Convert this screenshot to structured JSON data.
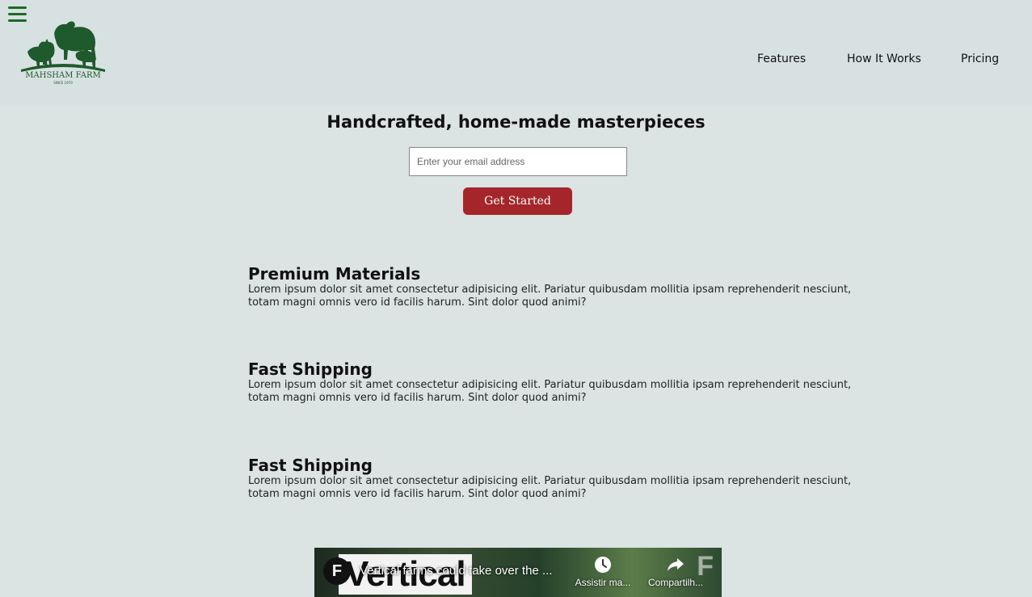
{
  "header": {
    "logo_text": "MAHSHAM FARM",
    "logo_subtext": "SINCE 1970",
    "nav": [
      "Features",
      "How It Works",
      "Pricing"
    ]
  },
  "hero": {
    "title": "Handcrafted, home-made masterpieces",
    "email_placeholder": "Enter your email address",
    "cta_label": "Get Started"
  },
  "features": [
    {
      "title": "Premium Materials",
      "text": "Lorem ipsum dolor sit amet consectetur adipisicing elit. Pariatur quibusdam mollitia ipsam reprehenderit nesciunt, totam magni omnis vero id facilis harum. Sint dolor quod animi?"
    },
    {
      "title": "Fast Shipping",
      "text": "Lorem ipsum dolor sit amet consectetur adipisicing elit. Pariatur quibusdam mollitia ipsam reprehenderit nesciunt, totam magni omnis vero id facilis harum. Sint dolor quod animi?"
    },
    {
      "title": "Fast Shipping",
      "text": "Lorem ipsum dolor sit amet consectetur adipisicing elit. Pariatur quibusdam mollitia ipsam reprehenderit nesciunt, totam magni omnis vero id facilis harum. Sint dolor quod animi?"
    }
  ],
  "video": {
    "channel_initial": "F",
    "background_word": "Vertical",
    "title": "Vertical farms could take over the ...",
    "watch_later_label": "Assistir ma...",
    "share_label": "Compartilh..."
  },
  "colors": {
    "page_background": "#dbe3e3",
    "brand_green": "#1c6b24",
    "cta_red": "#a5262a"
  },
  "icons": {
    "menu": "hamburger-menu-icon",
    "watch_later": "clock-icon",
    "share": "share-arrow-icon"
  }
}
